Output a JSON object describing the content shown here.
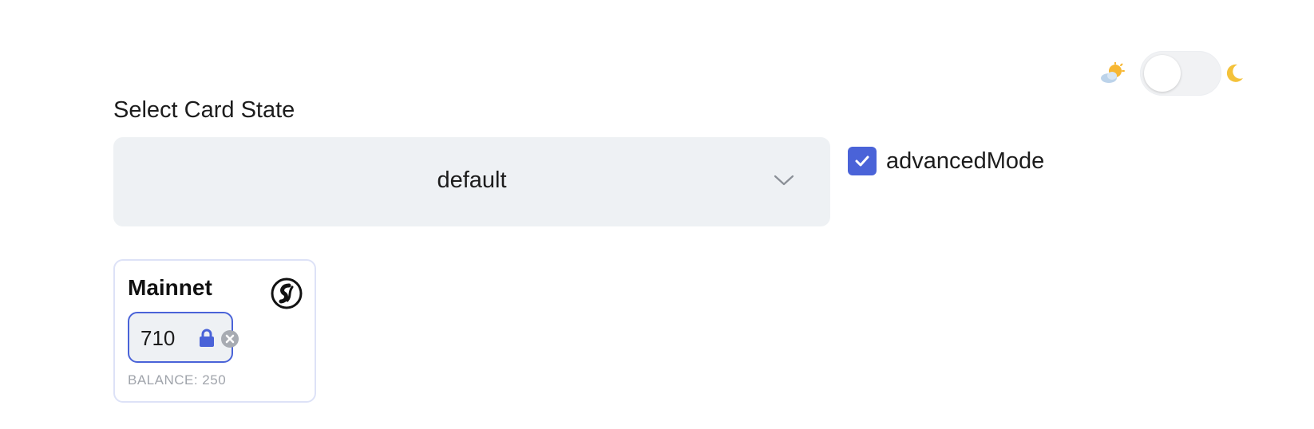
{
  "theme_toggle": {
    "state": "light",
    "left_icon": "sun-cloud-icon",
    "right_icon": "moon-icon"
  },
  "select": {
    "label": "Select Card State",
    "value": "default",
    "icon": "chevron-down-icon"
  },
  "checkbox": {
    "label": "advancedMode",
    "checked": true,
    "color": "#4a63d8"
  },
  "card": {
    "title": "Mainnet",
    "network_icon": "network-logo-icon",
    "amount": "710",
    "lock_icon": "lock-icon",
    "clear_icon": "clear-icon",
    "balance_label": "BALANCE: 250",
    "accent_color": "#4a63d8"
  }
}
